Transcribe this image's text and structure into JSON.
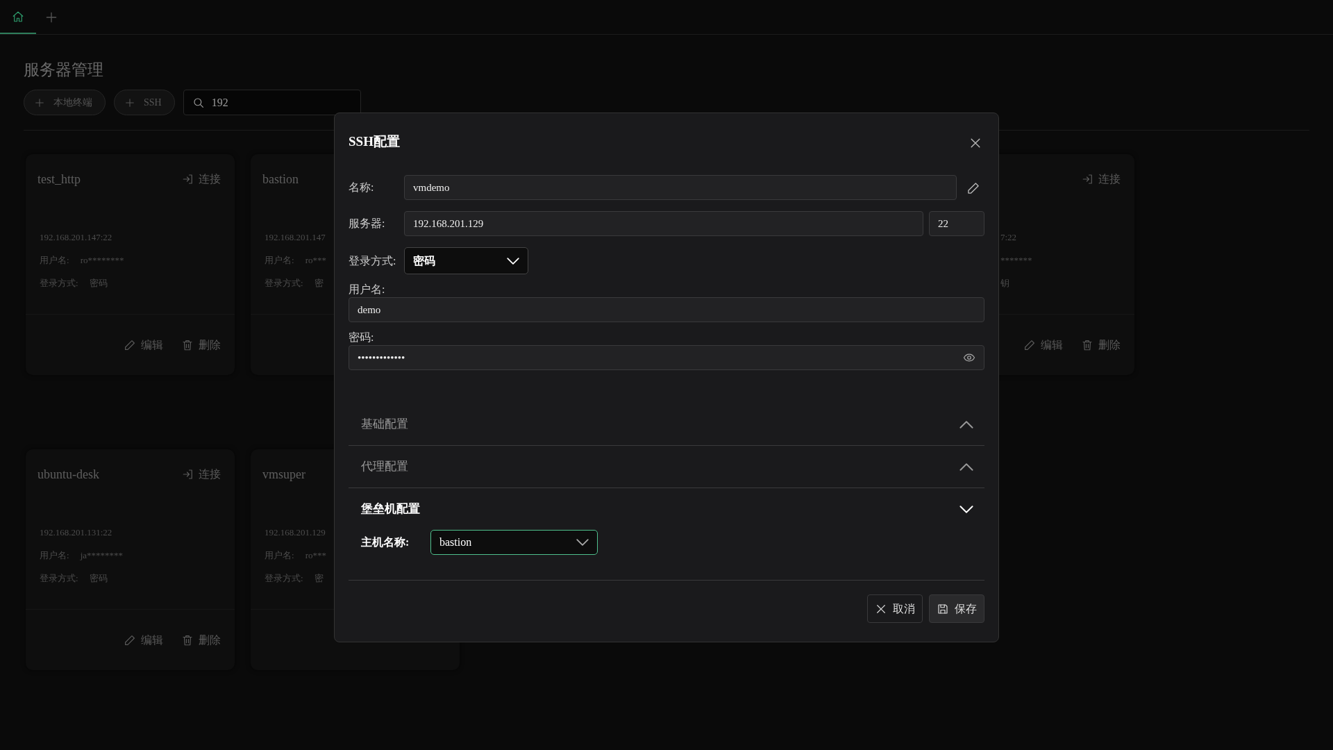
{
  "tabs": [
    {
      "selected": true
    }
  ],
  "page": {
    "title": "服务器管理",
    "buttons": [
      "本地终端",
      "SSH"
    ],
    "search": {
      "value": "192"
    }
  },
  "card_rows": [
    [
      {
        "name": "test_http",
        "connect": "连接",
        "host": "192.168.201.147:22",
        "username_label": "用户名:",
        "username": "ro********",
        "login_label": "登录方式:",
        "login": "密码",
        "edit": "编辑",
        "delete": "删除"
      },
      {
        "name": "bastion",
        "host": "192.168.201.147",
        "username_label": "用户名:",
        "username": "ro***",
        "login_label": "登录方式:",
        "login": "密"
      },
      {
        "connect": "连接",
        "host": "7:22",
        "username": "*******",
        "login": "钥",
        "edit": "编辑",
        "delete": "删除"
      }
    ],
    [
      {
        "name": "ubuntu-desk",
        "connect": "连接",
        "host": "192.168.201.131:22",
        "username_label": "用户名:",
        "username": "ja********",
        "login_label": "登录方式:",
        "login": "密码",
        "edit": "编辑",
        "delete": "删除"
      },
      {
        "name": "vmsuper",
        "host": "192.168.201.129",
        "username_label": "用户名:",
        "username": "ro***",
        "login_label": "登录方式:",
        "login": "密"
      }
    ]
  ],
  "dialog": {
    "title": "SSH配置",
    "name": {
      "label": "名称:",
      "value": "vmdemo"
    },
    "server": {
      "label": "服务器:",
      "host": "192.168.201.129",
      "port": "22"
    },
    "login_method": {
      "label": "登录方式:",
      "value": "密码"
    },
    "username": {
      "label": "用户名:",
      "value": "demo"
    },
    "password": {
      "label": "密码:",
      "value": "•••••••••••••"
    },
    "sections": [
      {
        "title": "基础配置",
        "expanded": false
      },
      {
        "title": "代理配置",
        "expanded": false
      },
      {
        "title": "堡垒机配置",
        "expanded": true,
        "fields": [
          {
            "label": "主机名称:",
            "value": "bastion",
            "focused": true
          }
        ]
      }
    ],
    "buttons": [
      {
        "kind": "cancel",
        "label": "取消"
      },
      {
        "kind": "save",
        "label": "保存"
      }
    ]
  }
}
